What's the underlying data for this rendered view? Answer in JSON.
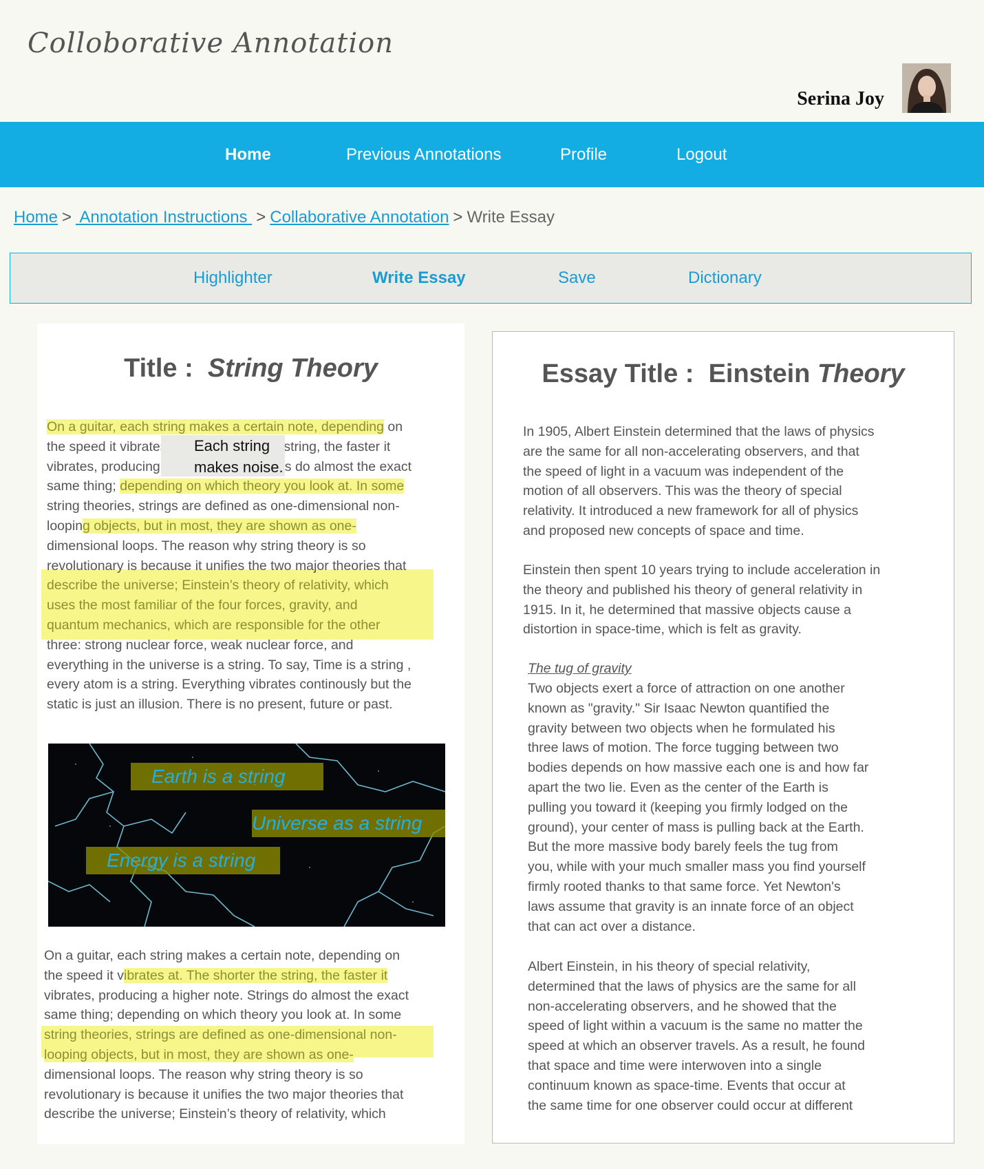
{
  "app": {
    "title": "Colloborative Annotation"
  },
  "user": {
    "name": "Serina Joy"
  },
  "nav": {
    "home": "Home",
    "previous": "Previous Annotations",
    "profile": "Profile",
    "logout": "Logout"
  },
  "breadcrumb": {
    "home": "Home",
    "sep": ">",
    "instructions": " Annotation Instructions ",
    "collab": "Collaborative Annotation",
    "current": "Write Essay"
  },
  "toolbar": {
    "highlighter": "Highlighter",
    "write_essay": "Write Essay",
    "save": "Save",
    "dictionary": "Dictionary"
  },
  "source": {
    "title_label": "Title :",
    "title_value": "String Theory",
    "note": [
      "Each string",
      "makes noise."
    ],
    "p1": [
      {
        "hl": "On a guitar, each string makes a certain note, depending",
        "b": " on"
      },
      {
        "a": "the speed it vibra",
        "b": "tes at. The shorter the string, the faster it"
      },
      {
        "a": "vibrates, producing a higher note. Strin",
        "b": "gs do almost the exact"
      },
      {
        "a": "same thing; ",
        "hl": "depending on which theory you look at. In some"
      },
      {
        "a": "string theories, strings are defined as one-dimensional non-"
      },
      {
        "a": "loopin",
        "hl": "g objects, but in most, they are shown as one-"
      },
      {
        "a": "dimensional loops. The reason why string theory is so"
      },
      {
        "a": "revolutionary is because it unifies the two major theories that"
      },
      {
        "hl": "describe the universe; Einstein’s theory of relativity, which"
      },
      {
        "hl": "uses the most familiar of the four forces, gravity, and"
      },
      {
        "hl": "quantum mechanics, which are responsible for the other"
      },
      {
        "a": "three: strong nuclear force, weak nuclear force, and"
      },
      {
        "a": "everything in the universe is a string. To say, Time is a string ,"
      },
      {
        "a": "every atom is a string. Everything vibrates continously but the"
      },
      {
        "a": "static is just an illusion. There is no present, future or past."
      }
    ],
    "image_labels": [
      "Earth is a string",
      "Universe as a string",
      "Energy is a string"
    ],
    "p2": [
      {
        "a": "On a guitar, each string makes a certain note, depending on"
      },
      {
        "a": "the speed it v",
        "hl": "ibrates at. The shorter the string, the faster it"
      },
      {
        "a": "vibrates, producing a higher note. Strings do almost the exact"
      },
      {
        "a": "same thing; depending on which theory you look at. In some"
      },
      {
        "hl": "string theories, strings are defined as one-dimensional non-"
      },
      {
        "hl": "looping objects, but in most, they are shown as one-"
      },
      {
        "a": "dimensional loops. The reason why string theory is so"
      },
      {
        "a": "revolutionary is because it unifies the two major theories that"
      },
      {
        "a": "describe the universe; Einstein’s theory of relativity, which"
      }
    ]
  },
  "essay": {
    "title_label": "Essay Title :",
    "title_word1": "Einstein",
    "title_word2": "Theory",
    "p1": [
      "In 1905, Albert Einstein determined that the laws of physics",
      "are the same for all non-accelerating observers, and that",
      "the speed of light in a vacuum was independent of the",
      "motion of all observers. This was the theory of special",
      "relativity. It introduced a new framework for all of physics",
      "and proposed new concepts of space and time."
    ],
    "p2": [
      "Einstein then spent 10 years trying to include acceleration in",
      "the theory and published his theory of general relativity in",
      "1915. In it, he determined that massive objects cause a",
      "distortion in space-time, which is felt as gravity."
    ],
    "subheading": "The tug of gravity",
    "p3": [
      "Two objects exert a force of attraction on one another",
      "known as \"gravity.\" Sir Isaac Newton quantified the",
      "gravity between two objects when he formulated his",
      "three laws of motion. The force tugging between two",
      "bodies depends on how massive each one is and how far",
      "apart the two lie. Even as the center of the Earth is",
      "pulling you toward it (keeping you firmly lodged on the",
      "ground), your center of mass is pulling back at the Earth.",
      "But the more massive body barely feels the tug from",
      "you, while with your much smaller mass you find yourself",
      "firmly rooted thanks to that same force. Yet Newton's",
      "laws assume that gravity is an innate force of an object",
      "that can act over a distance."
    ],
    "p4": [
      "Albert Einstein, in his theory of special relativity,",
      "determined that the laws of physics are the same for all",
      "non-accelerating observers, and he showed that the",
      "speed of light within a vacuum is the same no matter the",
      "speed at which an observer travels. As a result, he found",
      "that space and time were interwoven into a single",
      "continuum known as space-time. Events that occur at",
      "the same time for one observer could occur at different"
    ]
  },
  "colors": {
    "accent": "#13ade3",
    "link": "#1a9bd4",
    "highlight": "#f6f68a",
    "background": "#f8f8f3"
  }
}
